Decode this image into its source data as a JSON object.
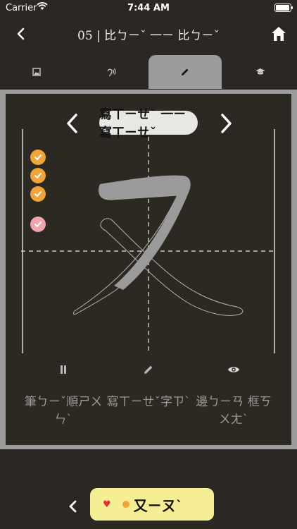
{
  "status": {
    "carrier": "Carrier",
    "time": "7:44 AM",
    "battery_fraction": 0.9
  },
  "nav": {
    "title": "05 | 比ㄅㄧˇ 一ㄧ 比ㄅㄧˇ",
    "back_icon": "chevron-left-icon",
    "home_icon": "home-icon"
  },
  "tabs": [
    {
      "icon": "image-icon",
      "active": false
    },
    {
      "icon": "listen-icon",
      "active": false
    },
    {
      "icon": "pencil-icon",
      "active": true
    },
    {
      "icon": "graduation-cap-icon",
      "active": false
    }
  ],
  "practice": {
    "mode_label": "寫ㄒㄧㄝˇ 一ㄧ 寫ㄒㄧㄝˇ",
    "character": "又",
    "checks": [
      {
        "state": "done",
        "color": "#f0a43c"
      },
      {
        "state": "done",
        "color": "#f0a43c"
      },
      {
        "state": "done",
        "color": "#f0a43c"
      },
      {
        "state": "done",
        "color": "#f0a4ad"
      }
    ],
    "tools": [
      {
        "icon": "pause-icon",
        "label": "筆ㄅㄧˇ順ㄕㄨㄣˋ"
      },
      {
        "icon": "pencil-icon",
        "label": "寫ㄒㄧㄝˇ字ㄗˋ"
      },
      {
        "icon": "eye-icon",
        "label": "邊ㄅㄧㄢ 框ㄎㄨㄤˋ"
      }
    ]
  },
  "bottom": {
    "character": "又ㄧㄡˋ",
    "heart_color": "#e0322c",
    "card_color": "#f6ee95"
  },
  "colors": {
    "background": "#2b2722",
    "panel": "#9c9c9c",
    "accent": "#f0a43c"
  }
}
